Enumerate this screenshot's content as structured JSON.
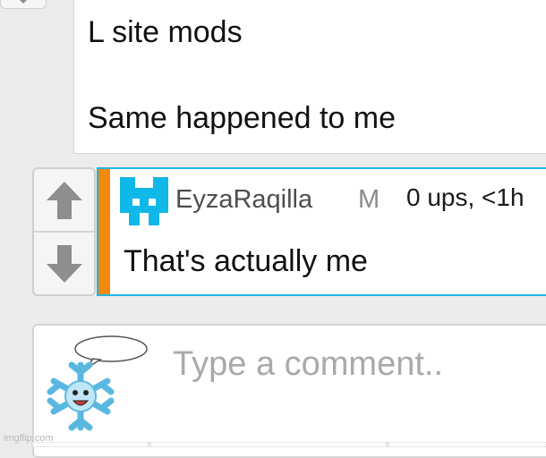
{
  "top_comment": {
    "line1": "L site mods",
    "line2": "Same happened to me"
  },
  "reply": {
    "username": "EyzaRaqilla",
    "badge": "M",
    "meta": "0 ups, <1h",
    "text": "That's actually me"
  },
  "composer": {
    "placeholder": "Type a comment.."
  },
  "watermark": "imgflip.com",
  "colors": {
    "accent_orange": "#f28a0e",
    "border_blue": "#1cb6e8",
    "avatar_blue": "#0fb8e8",
    "arrow_gray": "#8e8e8e"
  }
}
